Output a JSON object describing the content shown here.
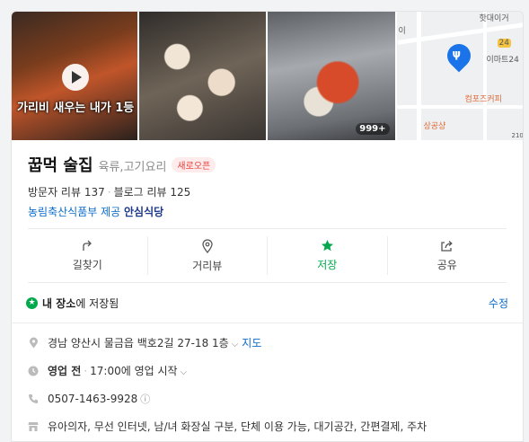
{
  "photos": {
    "video_caption": "가리비 새우는 내가 1등",
    "photo_count": "999+"
  },
  "map": {
    "labels": [
      "핫대이거",
      "이마트24",
      "컴포즈커피",
      "상공샹",
      "이",
      "24",
      "210"
    ]
  },
  "place": {
    "name": "꿉먹 술집",
    "category": "육류,고기요리",
    "badge": "새로오픈",
    "visitor_reviews": "방문자 리뷰 137",
    "blog_reviews": "블로그 리뷰 125",
    "provider": "농림축산식품부 제공",
    "provider_brand": "안심식당"
  },
  "actions": [
    {
      "label": "길찾기",
      "icon": "directions-icon"
    },
    {
      "label": "거리뷰",
      "icon": "location-pin-icon"
    },
    {
      "label": "저장",
      "icon": "star-icon"
    },
    {
      "label": "공유",
      "icon": "share-icon"
    }
  ],
  "saved": {
    "bold": "내 장소",
    "text": "에 저장됨",
    "edit": "수정"
  },
  "info": {
    "address": "경남 양산시 물금읍 백호2길 27-18 1층",
    "map_link": "지도",
    "status_bold": "영업 전",
    "status_text": "17:00에 영업 시작",
    "phone": "0507-1463-9928",
    "amenities": "유아의자, 무선 인터넷, 남/녀 화장실 구분, 단체 이용 가능, 대기공간, 간편결제, 주차"
  },
  "colors": {
    "accent_green": "#03a94c",
    "link_blue": "#0b6bcb",
    "badge_red": "#e8413e",
    "map_pin": "#1a73e8"
  }
}
